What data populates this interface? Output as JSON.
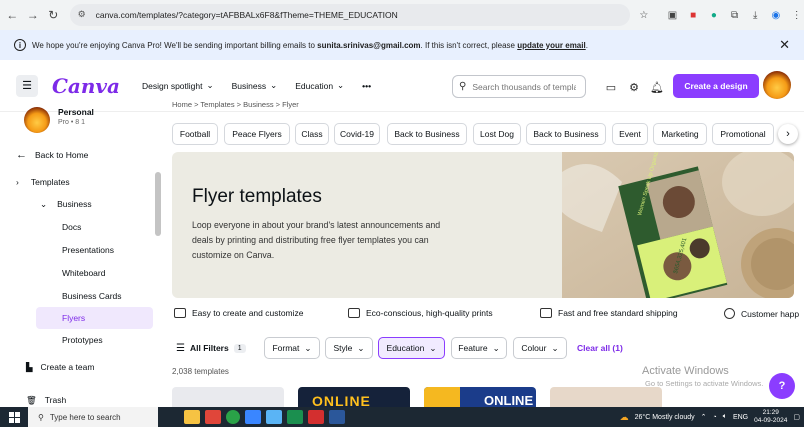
{
  "browser": {
    "url": "canva.com/templates/?category=tAFBBALx6F8&fTheme=THEME_EDUCATION"
  },
  "banner": {
    "text_pre": "We hope you're enjoying Canva Pro! We'll be sending important billing emails to",
    "email": "sunita.srinivas@gmail.com",
    "text_post": ". If this isn't correct, please",
    "link": "update your email",
    "text_end": "."
  },
  "header": {
    "logo": "Canva",
    "nav": [
      "Design spotlight",
      "Business",
      "Education",
      "•••"
    ],
    "search_placeholder": "Search thousands of templates",
    "create_label": "Create a design"
  },
  "sidebar": {
    "user_name": "Personal",
    "user_sub": "Pro • 8 1",
    "back": "Back to Home",
    "items": [
      {
        "label": "Templates"
      },
      {
        "label": "Business"
      },
      {
        "label": "Docs"
      },
      {
        "label": "Presentations"
      },
      {
        "label": "Whiteboard"
      },
      {
        "label": "Business Cards"
      },
      {
        "label": "Flyers"
      },
      {
        "label": "Prototypes"
      }
    ],
    "create_team": "Create a team",
    "trash": "Trash"
  },
  "main": {
    "breadcrumb": "Home  >  Templates  >  Business  >  Flyer",
    "chips": [
      "Football",
      "Peace Flyers",
      "Class",
      "Covid-19",
      "Back to Business",
      "Lost Dog",
      "Back to Business",
      "Event",
      "Marketing",
      "Promotional"
    ],
    "hero": {
      "title": "Flyer templates",
      "desc": "Loop everyone in about your brand's latest announcements and deals by printing and distributing free flyer templates you can customize on Canva.",
      "flyer_text": "Women Speak Up Organization",
      "flyer_amount": "$654,325,401"
    },
    "features": [
      "Easy to create and customize",
      "Eco-conscious, high-quality prints",
      "Fast and free standard shipping",
      "Customer happ"
    ],
    "filters": {
      "all_filters": "All Filters",
      "all_count": "1",
      "dropdowns": [
        "Format",
        "Style",
        "Education",
        "Feature",
        "Colour"
      ],
      "clear": "Clear all (1)"
    },
    "count": "2,038 templates",
    "thumb_texts": [
      "ONLINE",
      "ONLINE"
    ]
  },
  "windows_mark": {
    "title": "Activate Windows",
    "sub": "Go to Settings to activate Windows."
  },
  "taskbar": {
    "search": "Type here to search",
    "weather": "26°C  Mostly cloudy",
    "lang": "ENG",
    "time": "21:29",
    "date": "04-09-2024"
  },
  "colors": {
    "accent": "#8b3dff",
    "logo": "#7d2ae8",
    "hero_bg": "#ecebe3"
  }
}
